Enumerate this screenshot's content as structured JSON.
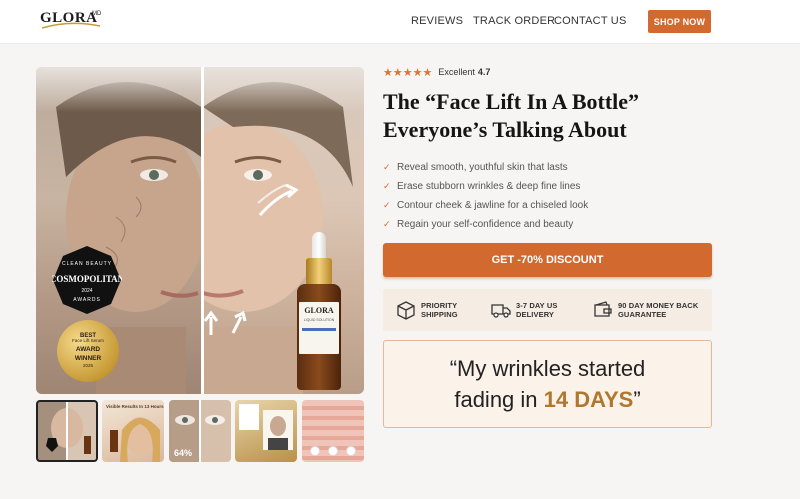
{
  "header": {
    "logo": {
      "text": "GLORA",
      "superscript": "MD"
    },
    "nav": [
      "REVIEWS",
      "TRACK ORDER",
      "CONTACT US"
    ],
    "shop_button": "SHOP NOW"
  },
  "hero_image": {
    "badge_cosmo": {
      "top": "CLEAN BEAUTY",
      "brand": "COSMOPOLITAN",
      "year": "2024",
      "bottom": "AWARDS"
    },
    "badge_award": {
      "line1": "BEST",
      "line2": "Face Lift Serum",
      "line3": "AWARD",
      "line4": "WINNER",
      "line5": "2025"
    },
    "bottle_label": {
      "brand": "GLORA",
      "superscript": "MD",
      "product": "LIQUID SOLUTION"
    }
  },
  "thumbnails": [
    {
      "name": "thumb-before-after"
    },
    {
      "name": "thumb-visible-results",
      "caption": "Visible Results In 13 Hours"
    },
    {
      "name": "thumb-closeup",
      "percent": "64%"
    },
    {
      "name": "thumb-testimonial"
    },
    {
      "name": "thumb-skin-layers"
    }
  ],
  "product": {
    "rating": {
      "stars": "★★★★★",
      "label": "Excellent",
      "score": "4.7"
    },
    "headline_line1": "The “Face Lift In A Bottle”",
    "headline_line2": "Everyone’s Talking About",
    "benefits": [
      "Reveal smooth, youthful skin that lasts",
      "Erase stubborn wrinkles & deep fine lines",
      "Contour cheek & jawline for a chiseled look",
      "Regain your self-confidence and beauty"
    ],
    "cta": "GET -70% DISCOUNT",
    "features": [
      {
        "line1": "PRIORITY",
        "line2": "SHIPPING",
        "icon": "box-icon"
      },
      {
        "line1": "3-7 DAY US",
        "line2": "DELIVERY",
        "icon": "truck-icon"
      },
      {
        "line1": "90 DAY MONEY BACK",
        "line2": "GUARANTEE",
        "icon": "wallet-icon"
      }
    ],
    "quote": {
      "line1": "“My wrinkles started",
      "line2_prefix": "fading in ",
      "highlight": "14 DAYS",
      "line2_suffix": "”"
    }
  },
  "colors": {
    "accent": "#d2692e",
    "star": "#e0732f",
    "highlight": "#b0782e",
    "quote_bg": "#fbf2ea"
  }
}
